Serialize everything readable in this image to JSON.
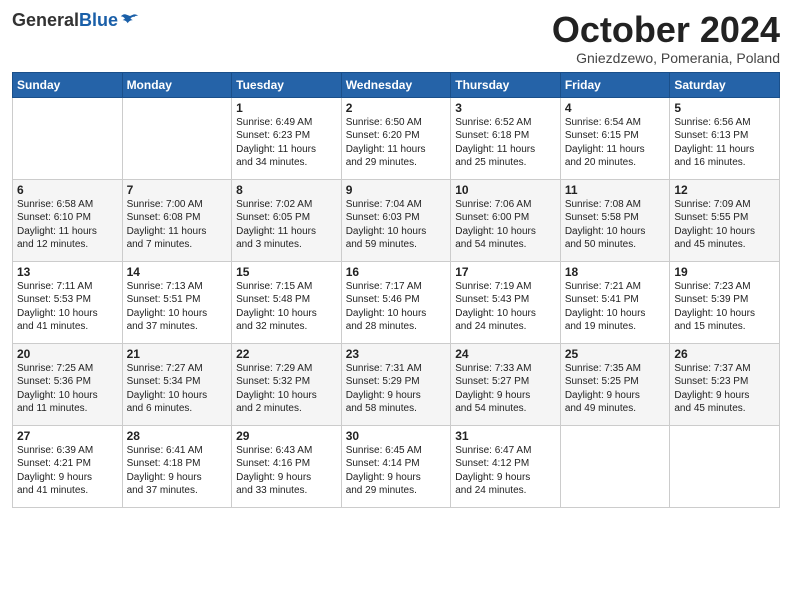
{
  "header": {
    "logo": {
      "general": "General",
      "blue": "Blue"
    },
    "title": "October 2024",
    "location": "Gniezdzewo, Pomerania, Poland"
  },
  "days_of_week": [
    "Sunday",
    "Monday",
    "Tuesday",
    "Wednesday",
    "Thursday",
    "Friday",
    "Saturday"
  ],
  "weeks": [
    [
      {
        "day": "",
        "info": ""
      },
      {
        "day": "",
        "info": ""
      },
      {
        "day": "1",
        "info": "Sunrise: 6:49 AM\nSunset: 6:23 PM\nDaylight: 11 hours\nand 34 minutes."
      },
      {
        "day": "2",
        "info": "Sunrise: 6:50 AM\nSunset: 6:20 PM\nDaylight: 11 hours\nand 29 minutes."
      },
      {
        "day": "3",
        "info": "Sunrise: 6:52 AM\nSunset: 6:18 PM\nDaylight: 11 hours\nand 25 minutes."
      },
      {
        "day": "4",
        "info": "Sunrise: 6:54 AM\nSunset: 6:15 PM\nDaylight: 11 hours\nand 20 minutes."
      },
      {
        "day": "5",
        "info": "Sunrise: 6:56 AM\nSunset: 6:13 PM\nDaylight: 11 hours\nand 16 minutes."
      }
    ],
    [
      {
        "day": "6",
        "info": "Sunrise: 6:58 AM\nSunset: 6:10 PM\nDaylight: 11 hours\nand 12 minutes."
      },
      {
        "day": "7",
        "info": "Sunrise: 7:00 AM\nSunset: 6:08 PM\nDaylight: 11 hours\nand 7 minutes."
      },
      {
        "day": "8",
        "info": "Sunrise: 7:02 AM\nSunset: 6:05 PM\nDaylight: 11 hours\nand 3 minutes."
      },
      {
        "day": "9",
        "info": "Sunrise: 7:04 AM\nSunset: 6:03 PM\nDaylight: 10 hours\nand 59 minutes."
      },
      {
        "day": "10",
        "info": "Sunrise: 7:06 AM\nSunset: 6:00 PM\nDaylight: 10 hours\nand 54 minutes."
      },
      {
        "day": "11",
        "info": "Sunrise: 7:08 AM\nSunset: 5:58 PM\nDaylight: 10 hours\nand 50 minutes."
      },
      {
        "day": "12",
        "info": "Sunrise: 7:09 AM\nSunset: 5:55 PM\nDaylight: 10 hours\nand 45 minutes."
      }
    ],
    [
      {
        "day": "13",
        "info": "Sunrise: 7:11 AM\nSunset: 5:53 PM\nDaylight: 10 hours\nand 41 minutes."
      },
      {
        "day": "14",
        "info": "Sunrise: 7:13 AM\nSunset: 5:51 PM\nDaylight: 10 hours\nand 37 minutes."
      },
      {
        "day": "15",
        "info": "Sunrise: 7:15 AM\nSunset: 5:48 PM\nDaylight: 10 hours\nand 32 minutes."
      },
      {
        "day": "16",
        "info": "Sunrise: 7:17 AM\nSunset: 5:46 PM\nDaylight: 10 hours\nand 28 minutes."
      },
      {
        "day": "17",
        "info": "Sunrise: 7:19 AM\nSunset: 5:43 PM\nDaylight: 10 hours\nand 24 minutes."
      },
      {
        "day": "18",
        "info": "Sunrise: 7:21 AM\nSunset: 5:41 PM\nDaylight: 10 hours\nand 19 minutes."
      },
      {
        "day": "19",
        "info": "Sunrise: 7:23 AM\nSunset: 5:39 PM\nDaylight: 10 hours\nand 15 minutes."
      }
    ],
    [
      {
        "day": "20",
        "info": "Sunrise: 7:25 AM\nSunset: 5:36 PM\nDaylight: 10 hours\nand 11 minutes."
      },
      {
        "day": "21",
        "info": "Sunrise: 7:27 AM\nSunset: 5:34 PM\nDaylight: 10 hours\nand 6 minutes."
      },
      {
        "day": "22",
        "info": "Sunrise: 7:29 AM\nSunset: 5:32 PM\nDaylight: 10 hours\nand 2 minutes."
      },
      {
        "day": "23",
        "info": "Sunrise: 7:31 AM\nSunset: 5:29 PM\nDaylight: 9 hours\nand 58 minutes."
      },
      {
        "day": "24",
        "info": "Sunrise: 7:33 AM\nSunset: 5:27 PM\nDaylight: 9 hours\nand 54 minutes."
      },
      {
        "day": "25",
        "info": "Sunrise: 7:35 AM\nSunset: 5:25 PM\nDaylight: 9 hours\nand 49 minutes."
      },
      {
        "day": "26",
        "info": "Sunrise: 7:37 AM\nSunset: 5:23 PM\nDaylight: 9 hours\nand 45 minutes."
      }
    ],
    [
      {
        "day": "27",
        "info": "Sunrise: 6:39 AM\nSunset: 4:21 PM\nDaylight: 9 hours\nand 41 minutes."
      },
      {
        "day": "28",
        "info": "Sunrise: 6:41 AM\nSunset: 4:18 PM\nDaylight: 9 hours\nand 37 minutes."
      },
      {
        "day": "29",
        "info": "Sunrise: 6:43 AM\nSunset: 4:16 PM\nDaylight: 9 hours\nand 33 minutes."
      },
      {
        "day": "30",
        "info": "Sunrise: 6:45 AM\nSunset: 4:14 PM\nDaylight: 9 hours\nand 29 minutes."
      },
      {
        "day": "31",
        "info": "Sunrise: 6:47 AM\nSunset: 4:12 PM\nDaylight: 9 hours\nand 24 minutes."
      },
      {
        "day": "",
        "info": ""
      },
      {
        "day": "",
        "info": ""
      }
    ]
  ]
}
